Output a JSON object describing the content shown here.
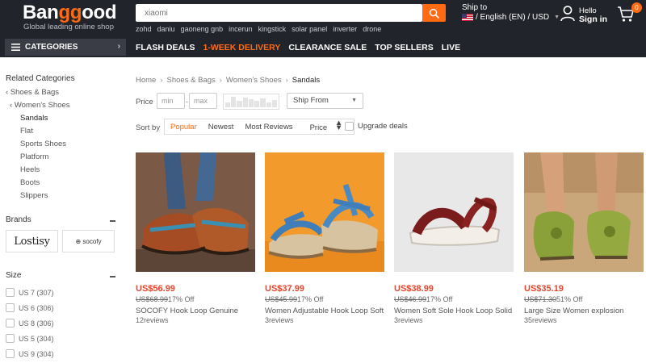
{
  "header": {
    "logo_pre": "Ban",
    "logo_gg": "gg",
    "logo_post": "ood",
    "tagline": "Global leading online shop",
    "search_placeholder": "xiaomi",
    "hot_words": [
      "zohd",
      "daniu",
      "gaoneng gnb",
      "incerun",
      "kingstick",
      "solar panel",
      "inverter",
      "drone"
    ],
    "ship_to_label": "Ship to",
    "ship_to_value": "/ English (EN) / USD",
    "hello": "Hello",
    "sign_in": "Sign in",
    "cart_count": "0"
  },
  "nav": {
    "categories": "CATEGORIES",
    "links": [
      "FLASH DEALS",
      "1-WEEK DELIVERY",
      "CLEARANCE SALE",
      "TOP SELLERS",
      "LIVE"
    ]
  },
  "sidebar": {
    "related_title": "Related Categories",
    "related": [
      "Shoes & Bags",
      "Women's Shoes",
      "Sandals",
      "Flat",
      "Sports Shoes",
      "Platform",
      "Heels",
      "Boots",
      "Slippers"
    ],
    "brands_title": "Brands",
    "brands": [
      "Lostisy",
      "socofy"
    ],
    "size_title": "Size",
    "sizes": [
      "US 7 (307)",
      "US 6 (306)",
      "US 8 (306)",
      "US 5 (304)",
      "US 9 (304)"
    ]
  },
  "breadcrumb": [
    "Home",
    "Shoes & Bags",
    "Women's Shoes",
    "Sandals"
  ],
  "filters": {
    "price_label": "Price",
    "min_placeholder": "min",
    "max_placeholder": "max",
    "ship_from": "Ship From",
    "sort_label": "Sort by",
    "sort_options": [
      "Popular",
      "Newest",
      "Most Reviews",
      "Price"
    ],
    "upgrade_deals": "Upgrade deals"
  },
  "products": [
    {
      "price": "US$56.99",
      "old_price": "US$68.99",
      "off": "17% Off",
      "title": "SOCOFY Hook Loop Genuine",
      "reviews": "12reviews"
    },
    {
      "price": "US$37.99",
      "old_price": "US$45.99",
      "off": "17% Off",
      "title": "Women Adjustable Hook Loop Soft",
      "reviews": "3reviews"
    },
    {
      "price": "US$38.99",
      "old_price": "US$46.99",
      "off": "17% Off",
      "title": "Women Soft Sole Hook Loop Solid",
      "reviews": "3reviews"
    },
    {
      "price": "US$35.19",
      "old_price": "US$71.30",
      "off": "51% Off",
      "title": "Large Size Women explosion",
      "reviews": "35reviews"
    }
  ],
  "colors": {
    "accent": "#ff6a13",
    "header_bg": "#22242b",
    "price": "#e8442b"
  }
}
